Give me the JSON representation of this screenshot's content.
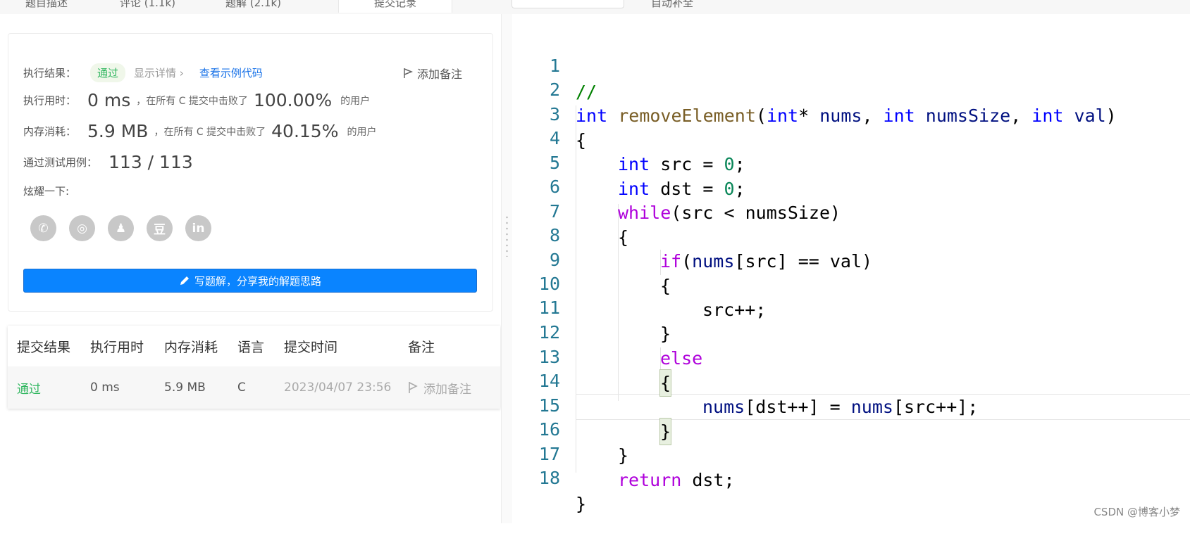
{
  "tabs": [
    {
      "label": "题目描述"
    },
    {
      "label": "评论 (1.1k)"
    },
    {
      "label": "题解 (2.1k)"
    },
    {
      "label": "提交记录"
    },
    {
      "label": "自动补全"
    },
    {
      "label": "提交记录"
    }
  ],
  "result": {
    "label_result": "执行结果：",
    "status": "通过",
    "detail": "显示详情 ›",
    "sample_link": "查看示例代码",
    "add_note": "添加备注",
    "label_time": "执行用时：",
    "time_value": "0 ms",
    "beat_text_1": "，在所有 C 提交中击败了",
    "time_percent": "100.00%",
    "users": "的用户",
    "label_memory": "内存消耗：",
    "memory_value": "5.9 MB",
    "beat_text_2": "，在所有 C 提交中击败了",
    "memory_percent": "40.15%",
    "users2": "的用户",
    "label_cases": "通过测试用例：",
    "cases": "113 / 113",
    "label_share": "炫耀一下:",
    "share_icons": [
      "wechat-icon",
      "weibo-icon",
      "qq-icon",
      "douban-icon",
      "linkedin-icon"
    ],
    "share_glyphs": [
      "✆",
      "◎",
      "♟",
      "豆",
      "in"
    ],
    "write_button": "写题解，分享我的解题思路"
  },
  "submissions": {
    "headers": [
      "提交结果",
      "执行用时",
      "内存消耗",
      "语言",
      "提交时间",
      "备注"
    ],
    "row": {
      "status": "通过",
      "time": "0 ms",
      "memory": "5.9 MB",
      "language": "C",
      "submitted": "2023/04/07 23:56",
      "note": "添加备注"
    }
  },
  "code": {
    "line_numbers": [
      "1",
      "2",
      "3",
      "4",
      "5",
      "6",
      "7",
      "8",
      "9",
      "10",
      "11",
      "12",
      "13",
      "14",
      "15",
      "16",
      "17",
      "18"
    ],
    "l1": "//",
    "l2_int": "int",
    "l2_fn": "removeElement",
    "l2_p1": "(",
    "l2_int2": "int",
    "l2_star": "* ",
    "l2_nums": "nums",
    "l2_comma1": ", ",
    "l2_int3": "int",
    "l2_numsSize": "numsSize",
    "l2_comma2": ", ",
    "l2_int4": "int",
    "l2_val": "val",
    "l2_p2": ")",
    "l3": "{",
    "l4_int": "int",
    "l4_rest": " src = ",
    "l4_num": "0",
    "l4_end": ";",
    "l5_int": "int",
    "l5_rest": " dst = ",
    "l5_num": "0",
    "l5_end": ";",
    "l6_kw": "while",
    "l6_rest": "(src < numsSize)",
    "l7": "{",
    "l8_kw": "if",
    "l8_p": "(",
    "l8_nums": "nums",
    "l8_rest": "[src] == val)",
    "l9": "{",
    "l10": "src++;",
    "l11": "}",
    "l12": "else",
    "l13": "{",
    "l14_nums1": "nums",
    "l14_mid": "[dst++] = ",
    "l14_nums2": "nums",
    "l14_end": "[src++];",
    "l15": "}",
    "l16": "}",
    "l17_kw": "return",
    "l17_rest": " dst;",
    "l18": "}"
  },
  "watermark": "CSDN @博客小梦"
}
